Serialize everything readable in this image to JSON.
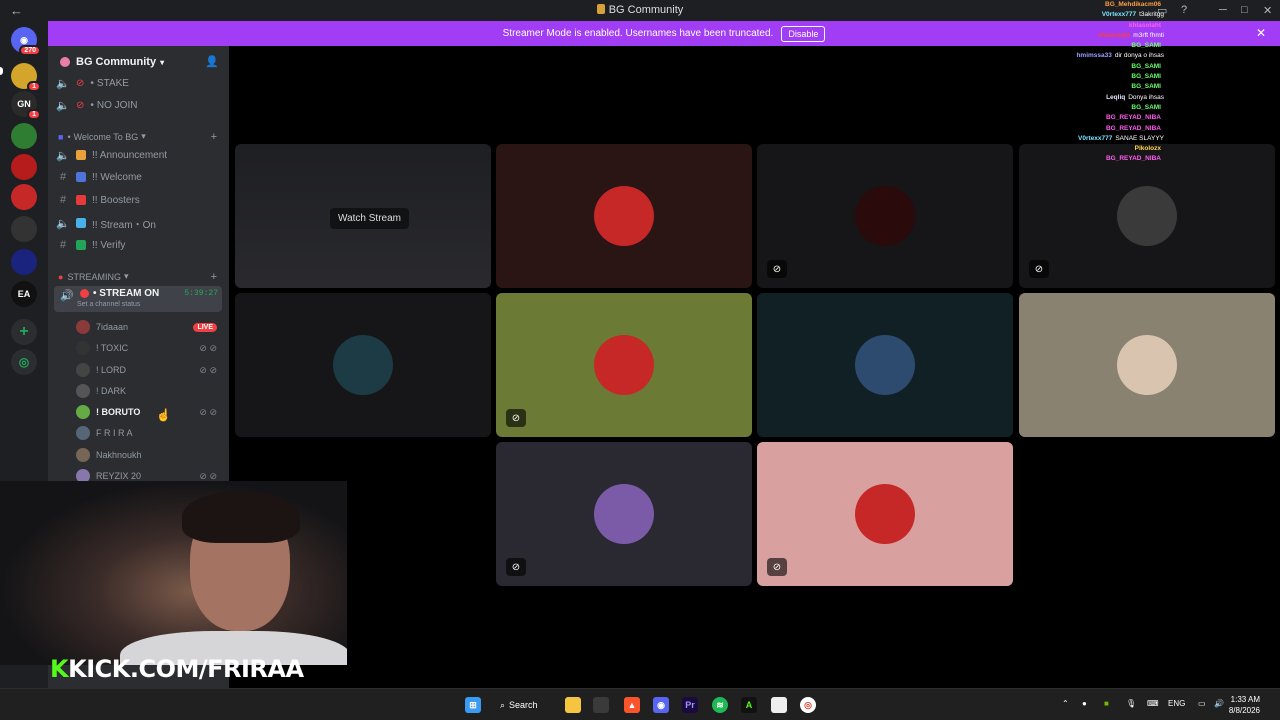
{
  "window": {
    "title": "BG Community"
  },
  "banner": {
    "text": "Streamer Mode is enabled. Usernames have been truncated.",
    "button": "Disable"
  },
  "rail": {
    "mentions_badge": "270",
    "servers": [
      {
        "badge": "1",
        "color": "#d4a52b",
        "label": ""
      },
      {
        "badge": "1",
        "color": "#2a2a2a",
        "label": "GN"
      },
      {
        "badge": "",
        "color": "#2e7d32",
        "label": ""
      },
      {
        "badge": "",
        "color": "#b71c1c",
        "label": ""
      },
      {
        "badge": "",
        "color": "#c62828",
        "label": ""
      },
      {
        "badge": "",
        "color": "#333",
        "label": ""
      },
      {
        "badge": "",
        "color": "#1a237e",
        "label": ""
      },
      {
        "badge": "",
        "color": "#111",
        "label": "EA"
      }
    ]
  },
  "sidebar": {
    "server_name": "BG Community",
    "top_channels": [
      "STAKE",
      "NO JOIN"
    ],
    "category_welcome": "Welcome To BG",
    "welcome_channels": [
      "!! Announcement",
      "!! Welcome",
      "!! Boosters",
      "!! Stream・On",
      "!! Verify"
    ],
    "category_streaming": "STREAMING",
    "active_channel": {
      "name": "STREAM ON",
      "time": "5:39:27",
      "status": "Set a channel status"
    },
    "members": [
      {
        "name": "7idaaan",
        "live": "LIVE"
      },
      {
        "name": "! TOXIC"
      },
      {
        "name": "! LORD"
      },
      {
        "name": "! DARK"
      },
      {
        "name": "! BORUTO"
      },
      {
        "name": "F R I R A"
      },
      {
        "name": "Nakhnoukh"
      },
      {
        "name": "REYZIX 20"
      }
    ]
  },
  "stream_tile": {
    "watch_label": "Watch Stream"
  },
  "tiles": [
    {
      "color": "#1a1a1c",
      "avatar": "#888"
    },
    {
      "color": "#2b1414",
      "avatar": "#c62828"
    },
    {
      "color": "#161618",
      "avatar": "#2a0a0a"
    },
    {
      "color": "#161618",
      "avatar": "#3a3a3a"
    },
    {
      "color": "#161618",
      "avatar": "#1c3b45"
    },
    {
      "color": "#6b7a34",
      "avatar": "#c62828"
    },
    {
      "color": "#102024",
      "avatar": "#2d4b6e"
    },
    {
      "color": "#8a8270",
      "avatar": "#d9c4b0"
    },
    {
      "color": "#2a2830",
      "avatar": "#7b5ba8"
    },
    {
      "color": "#d9a0a0",
      "avatar": "#c62828"
    }
  ],
  "chat": [
    {
      "name": "BG_Mehdikacm06",
      "msg": "",
      "color": "#ff9f43"
    },
    {
      "name": "V0rtexx777",
      "msg": "t3akritgg",
      "color": "#7de3ff"
    },
    {
      "name": "khlasolaht",
      "msg": "",
      "color": "#ff5ef0"
    },
    {
      "name": "khlasolaht",
      "msg": "m3rft fhmti",
      "color": "#ff3d3d"
    },
    {
      "name": "BG_SAMI",
      "msg": "",
      "color": "#6bff6b"
    },
    {
      "name": "hmimssa33",
      "msg": "dir donya o ihsas",
      "color": "#9aa0ff"
    },
    {
      "name": "BG_SAMI",
      "msg": "",
      "color": "#6bff6b"
    },
    {
      "name": "BG_SAMI",
      "msg": "",
      "color": "#6bff6b"
    },
    {
      "name": "BG_SAMI",
      "msg": "",
      "color": "#6bff6b"
    },
    {
      "name": "Leqliq",
      "msg": "Donya ihsas",
      "color": "#e6e6ff"
    },
    {
      "name": "BG_SAMI",
      "msg": "",
      "color": "#6bff6b"
    },
    {
      "name": "BG_REYAD_NIBA",
      "msg": "",
      "color": "#ff5ef0"
    },
    {
      "name": "BG_REYAD_NIBA",
      "msg": "",
      "color": "#ff5ef0"
    },
    {
      "name": "V0rtexx777",
      "msg": "SANAE SLAYYY",
      "color": "#7de3ff"
    },
    {
      "name": "Pikolozx",
      "msg": "",
      "color": "#ffd54f"
    },
    {
      "name": "BG_REYAD_NIBA",
      "msg": "",
      "color": "#ff5ef0"
    }
  ],
  "overlay": {
    "kick_prefix": "K",
    "kick_text": "KICK.COM/FRIRAA"
  },
  "taskbar": {
    "search": "Search",
    "lang": "ENG",
    "time": "1:33 AM",
    "date": "8/8/2026"
  }
}
